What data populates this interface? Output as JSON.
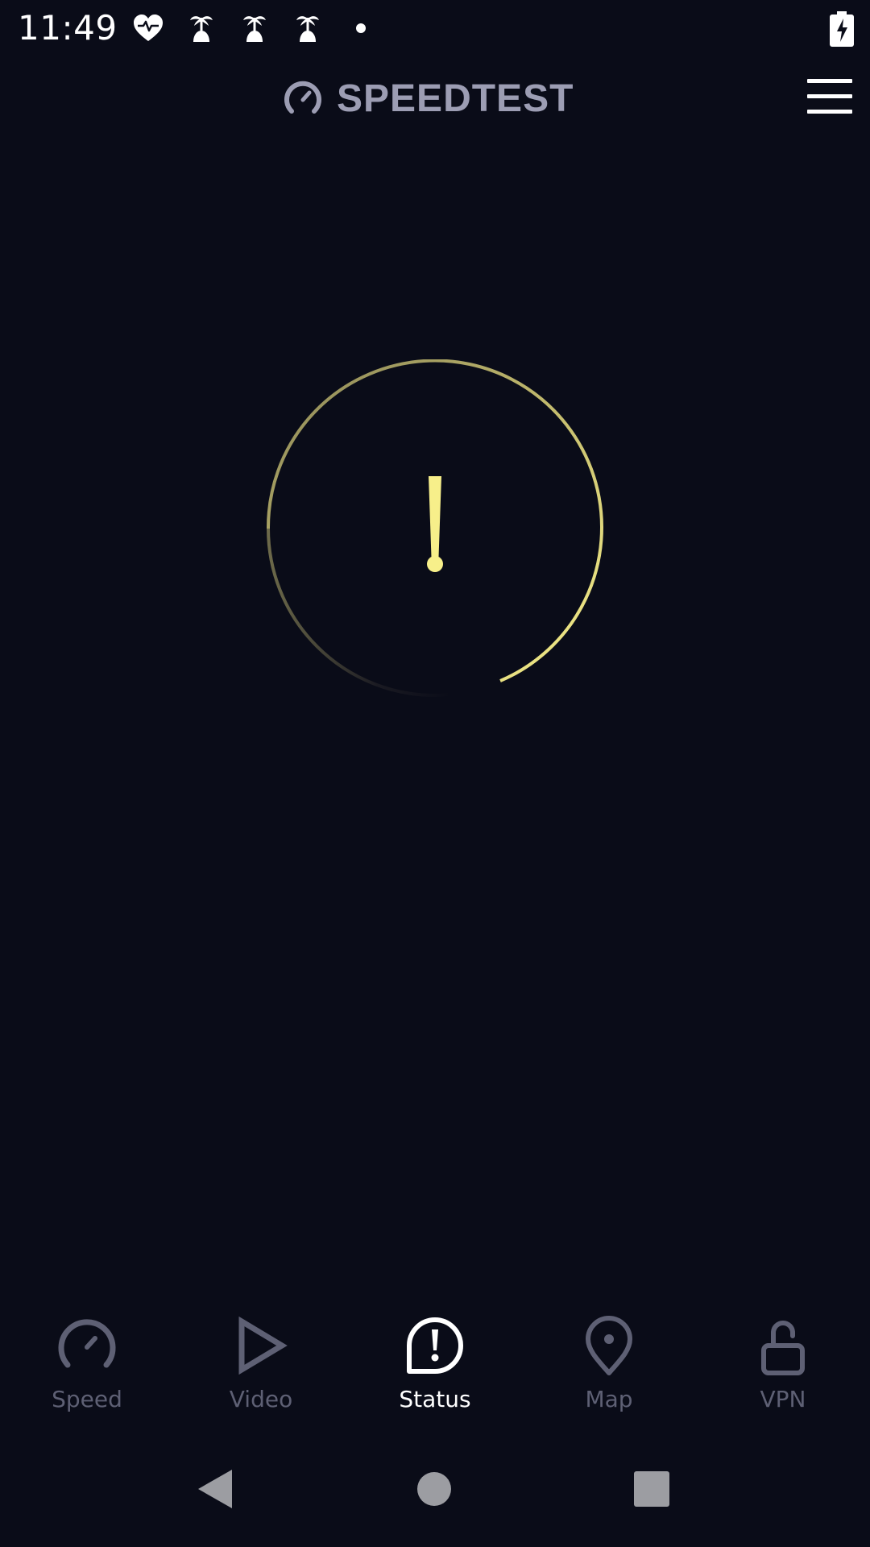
{
  "status_bar": {
    "time": "11:49",
    "icons": [
      "heart-pulse-icon",
      "palm-tree-icon",
      "palm-tree-icon",
      "palm-tree-icon",
      "dot-icon"
    ],
    "battery_icon": "battery-charging-icon"
  },
  "header": {
    "logo_text": "SPEEDTEST",
    "logo_icon": "speedometer-icon",
    "menu_icon": "hamburger-menu-icon"
  },
  "status_indicator": {
    "symbol": "!",
    "icon": "exclamation-icon",
    "accent_color": "#f7ef8a"
  },
  "bottom_nav": {
    "items": [
      {
        "label": "Speed",
        "icon": "speedometer-icon",
        "active": false
      },
      {
        "label": "Video",
        "icon": "play-icon",
        "active": false
      },
      {
        "label": "Status",
        "icon": "alert-bubble-icon",
        "active": true
      },
      {
        "label": "Map",
        "icon": "map-pin-icon",
        "active": false
      },
      {
        "label": "VPN",
        "icon": "unlock-icon",
        "active": false
      }
    ]
  },
  "system_nav": {
    "back_icon": "back-triangle-icon",
    "home_icon": "home-circle-icon",
    "recents_icon": "recents-square-icon"
  },
  "colors": {
    "background": "#0a0c18",
    "inactive": "#5e6074",
    "active": "#ffffff",
    "logo": "#9c9db3",
    "accent": "#f7ef8a"
  }
}
